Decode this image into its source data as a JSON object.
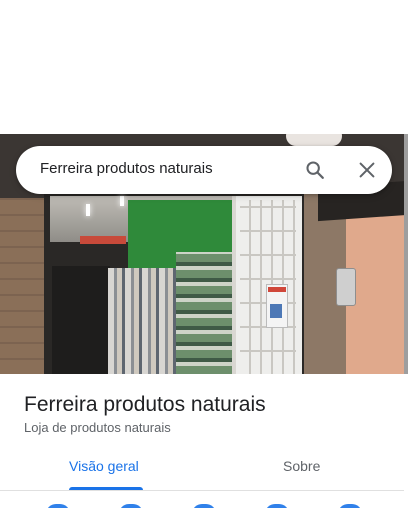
{
  "search": {
    "query": "Ferreira produtos naturais",
    "search_icon": "search-icon",
    "close_icon": "close-icon"
  },
  "photo": {
    "description_icon": "storefront-photo"
  },
  "place": {
    "name": "Ferreira produtos naturais",
    "category": "Loja de produtos naturais"
  },
  "tabs": [
    {
      "label": "Visão geral",
      "selected": true
    },
    {
      "label": "Sobre",
      "selected": false
    }
  ],
  "colors": {
    "accent": "#1a73e8",
    "text_primary": "#202124",
    "text_secondary": "#5f6368"
  }
}
